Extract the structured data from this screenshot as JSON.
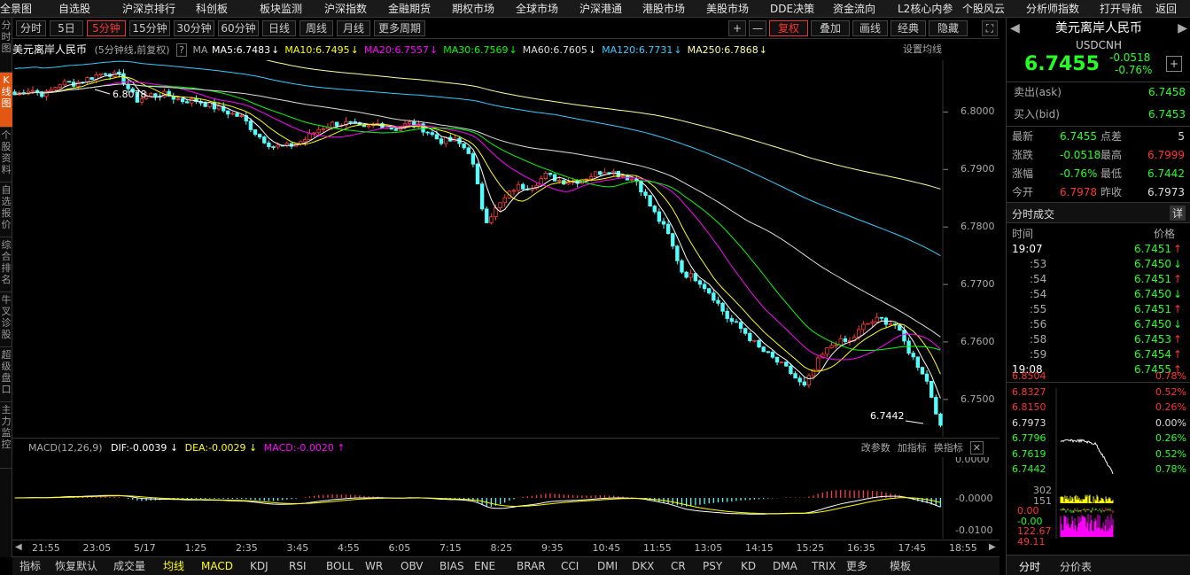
{
  "topnav": [
    "全景图",
    "自选股",
    "沪深京排行",
    "科创板",
    "板块监测",
    "沪深指数",
    "金融期货",
    "期权市场",
    "全球市场",
    "沪深港通",
    "港股市场",
    "美股市场",
    "DDE决策",
    "资金流向",
    "L2核心内参",
    "个股风云",
    "分析师指数",
    "打开导航",
    "返回"
  ],
  "lefttabs": [
    "分时图",
    "K线图",
    "个股资料",
    "自选报价",
    "综合排名",
    "牛叉诊股",
    "超级盘口",
    "主力监控"
  ],
  "toolbar": {
    "periods": [
      "分时",
      "5日",
      "5分钟",
      "15分钟",
      "30分钟",
      "60分钟",
      "日线",
      "周线",
      "月线",
      "更多周期"
    ],
    "selected": "5分钟",
    "right": [
      "+",
      "—",
      "复权",
      "叠加",
      "画线",
      "经典",
      "隐藏"
    ]
  },
  "maline": {
    "title": "美元离岸人民币",
    "desc": "(5分钟线,前复权)",
    "help": "?",
    "ma": "MA",
    "items": [
      {
        "t": "MA5:6.7483",
        "c": "#ffffff"
      },
      {
        "t": "MA10:6.7495",
        "c": "#ffff00"
      },
      {
        "t": "MA20:6.7557",
        "c": "#ff00ff"
      },
      {
        "t": "MA30:6.7569",
        "c": "#00ff00"
      },
      {
        "t": "MA60:6.7605",
        "c": "#dddddd"
      },
      {
        "t": "MA120:6.7731",
        "c": "#33ccff"
      },
      {
        "t": "MA250:6.7868",
        "c": "#ffff99"
      }
    ],
    "setting": "设置均线"
  },
  "main_axis": [
    "6.8000",
    "6.7900",
    "6.7800",
    "6.7700",
    "6.7600",
    "6.7500"
  ],
  "annot": {
    "high": "6.8078",
    "low": "6.7442"
  },
  "macd": {
    "title": "MACD(12,26,9)",
    "dif": "DIF:-0.0039",
    "dea": "DEA:-0.0029",
    "macd": "MACD:-0.0020",
    "right": [
      "改参数",
      "加指标",
      "换指标"
    ],
    "axis": [
      "0.0000",
      "-0.0000",
      "-0.0100"
    ]
  },
  "timeaxis": [
    "21:55",
    "23:05",
    "5/17",
    "1:25",
    "2:35",
    "3:45",
    "4:55",
    "6:05",
    "7:15",
    "8:25",
    "9:35",
    "10:45",
    "11:55",
    "13:05",
    "14:15",
    "15:25",
    "16:35",
    "17:45",
    "18:55"
  ],
  "bottomtabs": [
    "指标",
    "恢复默认",
    "成交量",
    "均线",
    "MACD",
    "KDJ",
    "RSI",
    "BOLL",
    "WR",
    "OBV",
    "BIAS",
    "ENE",
    "BRAR",
    "CCI",
    "DMI",
    "DKX",
    "CR",
    "PSY",
    "KD",
    "DMA",
    "TRIX",
    "更多",
    "模板"
  ],
  "right": {
    "name": "美元离岸人民币",
    "code": "USDCNH",
    "price": "6.7455",
    "chg": "-0.0518",
    "pct": "-0.76%",
    "ask_label": "卖出(ask)",
    "ask": "6.7458",
    "bid_label": "买入(bid)",
    "bid": "6.7453",
    "stats": [
      [
        "最新",
        "6.7455",
        "点差",
        "5"
      ],
      [
        "涨跌",
        "-0.0518",
        "最高",
        "6.7999"
      ],
      [
        "涨幅",
        "-0.76%",
        "最低",
        "6.7442"
      ],
      [
        "今开",
        "6.7978",
        "昨收",
        "6.7973"
      ]
    ],
    "deals_title": "分时成交",
    "deals_btn": "详",
    "deal_head": [
      "时间",
      "价格"
    ],
    "ticks": [
      [
        "19:07",
        "6.7451",
        "↑"
      ],
      [
        ":53",
        "6.7450",
        "↓"
      ],
      [
        ":54",
        "6.7451",
        "↑"
      ],
      [
        ":54",
        "6.7450",
        "↓"
      ],
      [
        ":55",
        "6.7451",
        "↑"
      ],
      [
        ":56",
        "6.7450",
        "↓"
      ],
      [
        ":58",
        "6.7453",
        "↑"
      ],
      [
        ":59",
        "6.7454",
        "↑"
      ],
      [
        "19:08",
        "6.7455",
        "↑"
      ]
    ],
    "mini_prices": [
      "6.8504",
      "6.8327",
      "6.8150",
      "6.7973",
      "6.7796",
      "6.7619",
      "6.7442"
    ],
    "mini_pcts": [
      "0.78%",
      "0.52%",
      "0.26%",
      "0.00%",
      "0.26%",
      "0.52%",
      "0.78%"
    ],
    "mini_vol": [
      "302",
      "151",
      "0.00",
      "-0.00",
      "122.67",
      "49.11"
    ],
    "tabs": [
      "分时",
      "分价表"
    ]
  },
  "chart_data": {
    "type": "candlestick",
    "ylim": [
      6.7435,
      6.809
    ],
    "close_path": [
      6.803,
      6.804,
      6.803,
      6.805,
      6.805,
      6.806,
      6.807,
      6.806,
      6.802,
      6.803,
      6.803,
      6.802,
      6.802,
      6.801,
      6.8,
      6.799,
      6.796,
      6.794,
      6.794,
      6.795,
      6.797,
      6.798,
      6.798,
      6.797,
      6.798,
      6.797,
      6.798,
      6.797,
      6.795,
      6.795,
      6.793,
      6.781,
      6.784,
      6.787,
      6.787,
      6.789,
      6.788,
      6.788,
      6.789,
      6.79,
      6.789,
      6.788,
      6.783,
      6.779,
      6.772,
      6.771,
      6.768,
      6.764,
      6.762,
      6.759,
      6.757,
      6.755,
      6.752,
      6.757,
      6.76,
      6.76,
      6.763,
      6.764,
      6.763,
      6.758,
      6.754,
      6.7455
    ]
  }
}
